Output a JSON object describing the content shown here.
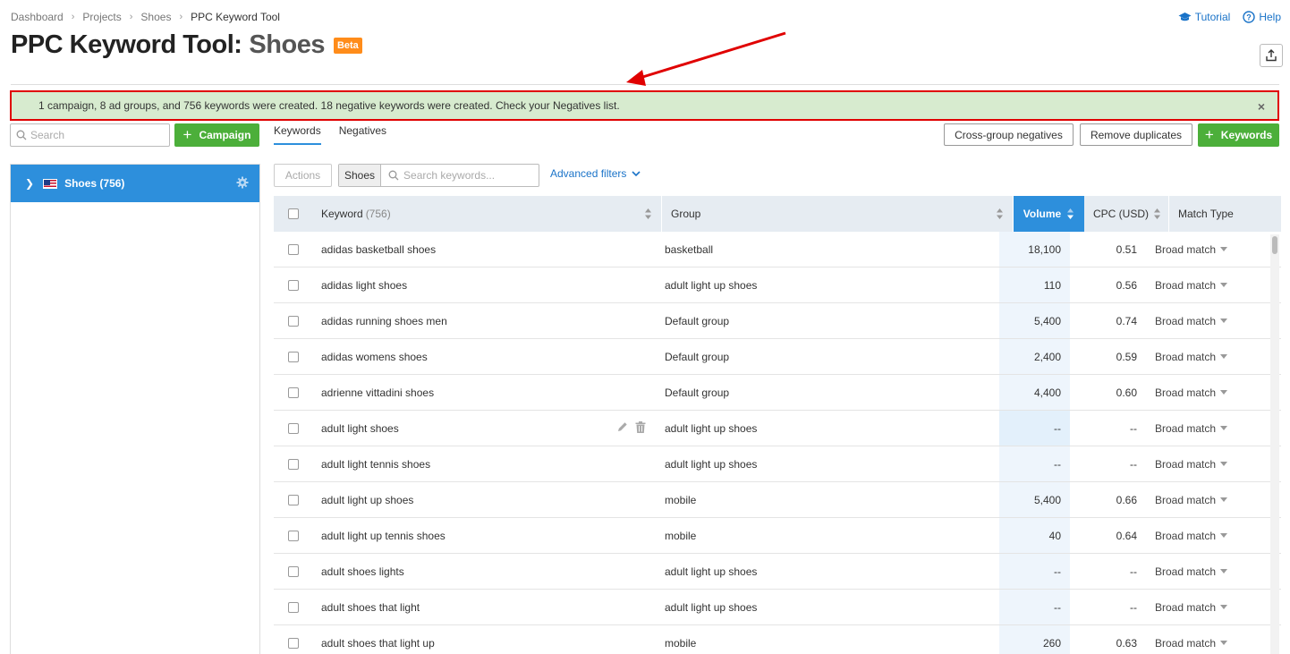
{
  "breadcrumb": [
    "Dashboard",
    "Projects",
    "Shoes",
    "PPC Keyword Tool"
  ],
  "title": {
    "tool": "PPC Keyword Tool:",
    "project": "Shoes",
    "badge": "Beta"
  },
  "top_links": {
    "tutorial": "Tutorial",
    "help": "Help"
  },
  "notice": {
    "text": "1 campaign, 8 ad groups, and 756 keywords were created. 18 negative keywords were created. Check your Negatives list.",
    "close": "×"
  },
  "sidebar": {
    "search_placeholder": "Search",
    "campaign_button": "Campaign",
    "items": [
      {
        "label": "Shoes (756)"
      }
    ]
  },
  "tabs": [
    "Keywords",
    "Negatives"
  ],
  "toolbar": {
    "cross_group": "Cross-group negatives",
    "remove_duplicates": "Remove duplicates",
    "add_keywords": "Keywords",
    "actions": "Actions",
    "filter_tag": "Shoes",
    "filter_placeholder": "Search keywords...",
    "advanced_filters": "Advanced filters"
  },
  "table": {
    "headers": {
      "keyword": "Keyword",
      "keyword_count": "(756)",
      "group": "Group",
      "volume": "Volume",
      "cpc": "CPC (USD)",
      "match_type": "Match Type"
    },
    "rows": [
      {
        "keyword": "adidas basketball shoes",
        "group": "basketball",
        "volume": "18,100",
        "cpc": "0.51",
        "match": "Broad match"
      },
      {
        "keyword": "adidas light shoes",
        "group": "adult light up shoes",
        "volume": "110",
        "cpc": "0.56",
        "match": "Broad match"
      },
      {
        "keyword": "adidas running shoes men",
        "group": "Default group",
        "volume": "5,400",
        "cpc": "0.74",
        "match": "Broad match"
      },
      {
        "keyword": "adidas womens shoes",
        "group": "Default group",
        "volume": "2,400",
        "cpc": "0.59",
        "match": "Broad match"
      },
      {
        "keyword": "adrienne vittadini shoes",
        "group": "Default group",
        "volume": "4,400",
        "cpc": "0.60",
        "match": "Broad match"
      },
      {
        "keyword": "adult light shoes",
        "group": "adult light up shoes",
        "volume": "--",
        "cpc": "--",
        "match": "Broad match"
      },
      {
        "keyword": "adult light tennis shoes",
        "group": "adult light up shoes",
        "volume": "--",
        "cpc": "--",
        "match": "Broad match"
      },
      {
        "keyword": "adult light up shoes",
        "group": "mobile",
        "volume": "5,400",
        "cpc": "0.66",
        "match": "Broad match"
      },
      {
        "keyword": "adult light up tennis shoes",
        "group": "mobile",
        "volume": "40",
        "cpc": "0.64",
        "match": "Broad match"
      },
      {
        "keyword": "adult shoes lights",
        "group": "adult light up shoes",
        "volume": "--",
        "cpc": "--",
        "match": "Broad match"
      },
      {
        "keyword": "adult shoes that light",
        "group": "adult light up shoes",
        "volume": "--",
        "cpc": "--",
        "match": "Broad match"
      },
      {
        "keyword": "adult shoes that light up",
        "group": "mobile",
        "volume": "260",
        "cpc": "0.63",
        "match": "Broad match"
      }
    ]
  },
  "colors": {
    "accent": "#2d8fdc",
    "green": "#4caf3a",
    "notice_bg": "#d7ebcf",
    "annotation": "#e00000",
    "badge": "#ff8c1a"
  },
  "icons": [
    "chevron-right-icon",
    "tutorial-cap-icon",
    "help-icon",
    "export-icon",
    "search-icon",
    "plus-icon",
    "us-flag-icon",
    "gear-icon",
    "sort-icon",
    "chevron-down-icon",
    "pencil-icon",
    "trash-icon",
    "close-icon"
  ]
}
